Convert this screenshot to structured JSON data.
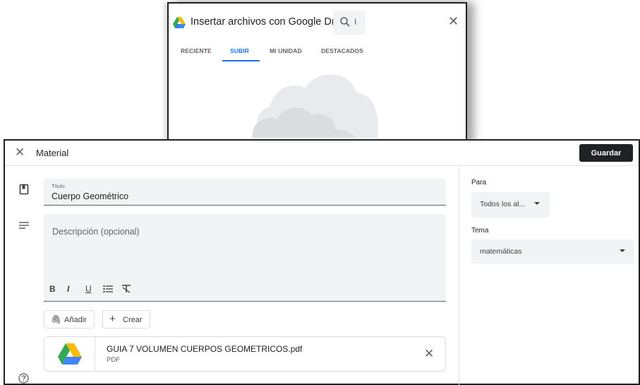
{
  "picker": {
    "title": "Insertar archivos con Google Drive",
    "search_caret": "I",
    "tabs": [
      {
        "label": "RECIENTE",
        "active": false
      },
      {
        "label": "SUBIR",
        "active": true
      },
      {
        "label": "MI UNIDAD",
        "active": false
      },
      {
        "label": "DESTACADOS",
        "active": false
      }
    ]
  },
  "editor": {
    "title": "Material",
    "save_label": "Guardar",
    "title_field": {
      "label": "Título",
      "value": "Cuerpo Geométrico"
    },
    "description": {
      "placeholder": "Descripción (opcional)"
    },
    "format_buttons": [
      "B",
      "I",
      "U",
      "list",
      "clear-format"
    ],
    "add_label": "Añadir",
    "create_label": "Crear",
    "attachment": {
      "name": "GUIA 7 VOLUMEN CUERPOS GEOMETRICOS.pdf",
      "type": "PDF"
    }
  },
  "side": {
    "for_label": "Para",
    "for_value": "Todos los al...",
    "topic_label": "Tema",
    "topic_value": "matemáticas"
  },
  "colors": {
    "accent": "#1a73e8",
    "save_button": "#202124",
    "field_bg": "#f1f3f4"
  },
  "icons": [
    "google-drive-icon",
    "search-icon",
    "close-icon",
    "book-icon",
    "description-icon",
    "paperclip-icon",
    "plus-icon",
    "help-icon",
    "dropdown-arrow-icon"
  ]
}
